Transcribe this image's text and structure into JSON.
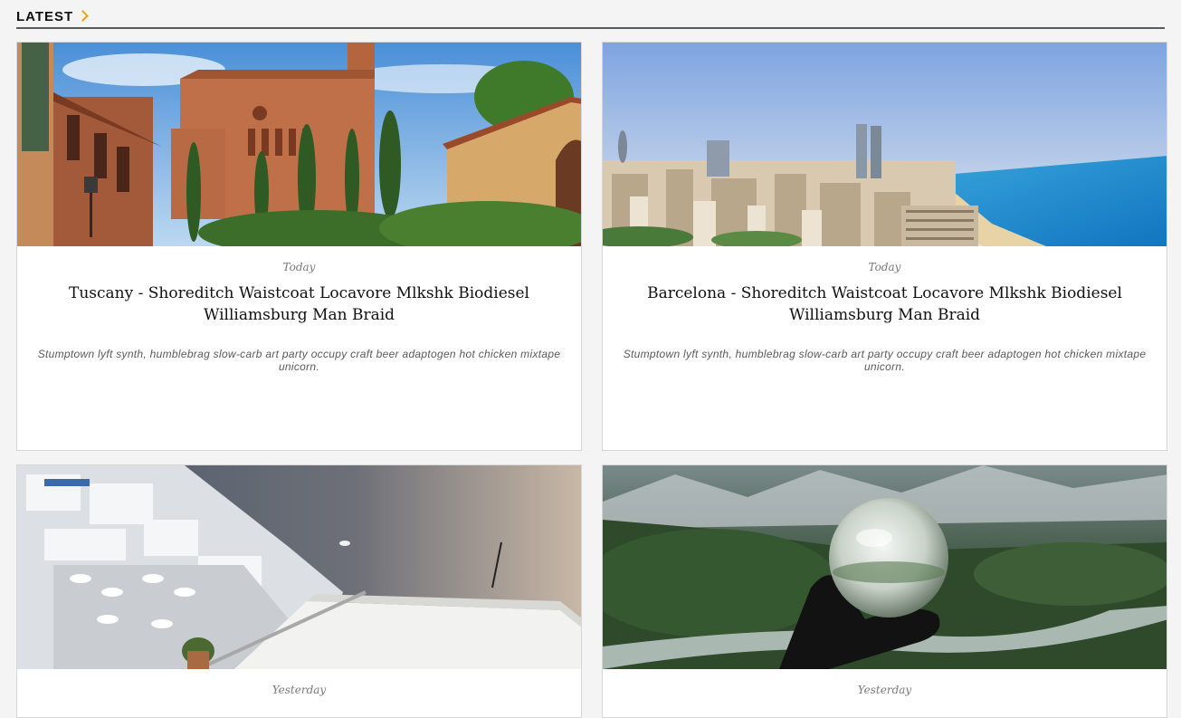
{
  "section": {
    "title": "LATEST",
    "arrow_icon": "chevron-right-icon",
    "accent_color": "#f0a020"
  },
  "cards": [
    {
      "image_alt": "Tuscany church and brick buildings under blue sky",
      "date": "Today",
      "title": "Tuscany - Shoreditch Waistcoat Locavore Mlkshk Biodiesel Williamsburg Man Braid",
      "excerpt": "Stumptown lyft synth, humblebrag slow-carb art party occupy craft beer adaptogen hot chicken mixtape unicorn."
    },
    {
      "image_alt": "Barcelona city skyline and beach",
      "date": "Today",
      "title": "Barcelona - Shoreditch Waistcoat Locavore Mlkshk Biodiesel Williamsburg Man Braid",
      "excerpt": "Stumptown lyft synth, humblebrag slow-carb art party occupy craft beer adaptogen hot chicken mixtape unicorn."
    },
    {
      "image_alt": "White terraces overlooking the sea",
      "date": "Yesterday",
      "title": "",
      "excerpt": ""
    },
    {
      "image_alt": "Hand holding a crystal ball in a mountain landscape",
      "date": "Yesterday",
      "title": "",
      "excerpt": ""
    }
  ]
}
